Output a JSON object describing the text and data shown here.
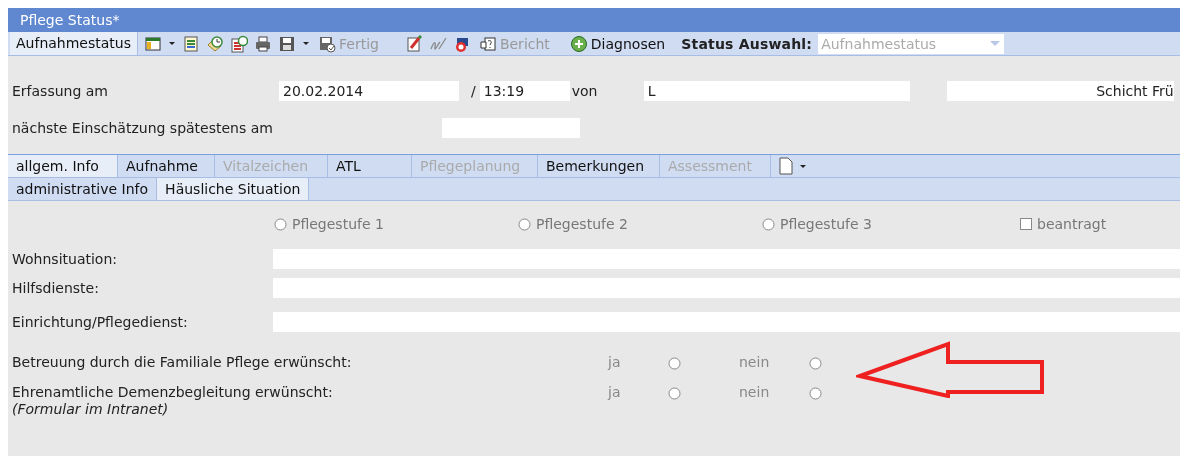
{
  "window": {
    "title": "Pflege Status*"
  },
  "toolbar": {
    "tab": {
      "label": "Aufnahmestatus",
      "selected": true
    },
    "buttons": [
      {
        "label": "Fertig",
        "disabled": true
      },
      {
        "label": "Bericht",
        "disabled": true
      },
      {
        "label": "Diagnosen",
        "disabled": false
      }
    ],
    "status_select": {
      "label": "Status Auswahl:",
      "value": "Aufnahmestatus",
      "disabled": true
    }
  },
  "header": {
    "erfassung": {
      "label": "Erfassung am",
      "date": "20.02.2014",
      "separator": "/",
      "time": "13:19",
      "by_label": "von",
      "by_value": "L",
      "shift": "Schicht Frü"
    },
    "next": {
      "label": "nächste Einschätzung spätestens am"
    }
  },
  "tabs": [
    {
      "label": "allgem. Info",
      "selected": true,
      "disabled": false
    },
    {
      "label": "Aufnahme",
      "selected": false,
      "disabled": false
    },
    {
      "label": "Vitalzeichen",
      "selected": false,
      "disabled": true
    },
    {
      "label": "ATL",
      "selected": false,
      "disabled": false
    },
    {
      "label": "Pflegeplanung",
      "selected": false,
      "disabled": true
    },
    {
      "label": "Bemerkungen",
      "selected": false,
      "disabled": false
    },
    {
      "label": "Assessment",
      "selected": false,
      "disabled": true
    }
  ],
  "subtabs": [
    {
      "label": "administrative Info",
      "selected": false
    },
    {
      "label": "Häusliche Situation",
      "selected": true
    }
  ],
  "pflegestufe": {
    "options": [
      {
        "label": "Pflegestufe 1",
        "selected": false
      },
      {
        "label": "Pflegestufe 2",
        "selected": false
      },
      {
        "label": "Pflegestufe 3",
        "selected": false
      }
    ],
    "beantragt": {
      "label": "beantragt",
      "checked": false
    }
  },
  "text_fields": [
    {
      "label": "Wohnsituation:"
    },
    {
      "label": "Hilfsdienste:"
    },
    {
      "label": "Einrichtung/Pflegedienst:"
    }
  ],
  "questions": [
    {
      "label": "Betreuung durch die Familiale Pflege erwünscht:",
      "options": [
        {
          "label": "ja",
          "selected": false
        },
        {
          "label": "nein",
          "selected": false
        }
      ]
    },
    {
      "label": "Ehrenamtliche Demenzbegleitung erwünscht:",
      "note": "(Formular im Intranet)",
      "options": [
        {
          "label": "ja",
          "selected": false
        },
        {
          "label": "nein",
          "selected": false
        }
      ]
    }
  ]
}
